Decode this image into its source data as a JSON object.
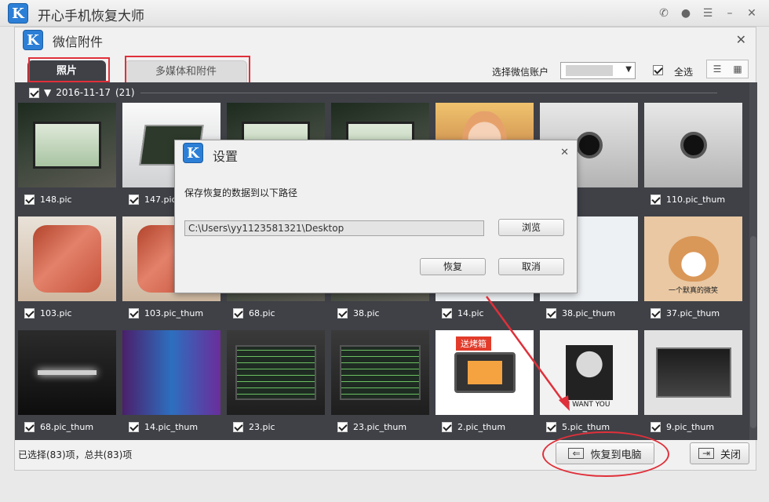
{
  "app": {
    "title": "开心手机恢复大师",
    "logo_letter": "K"
  },
  "dialog": {
    "title": "微信附件",
    "tabs": [
      {
        "label": "照片"
      },
      {
        "label": "多媒体和附件"
      }
    ],
    "account_label": "选择微信账户",
    "select_all_label": "全选",
    "group": {
      "date": "2016-11-17",
      "count": "(21)"
    },
    "items": [
      {
        "label": "148.pic",
        "img": "pc"
      },
      {
        "label": "147.pic",
        "img": "laptop"
      },
      {
        "label": "",
        "img": "pc"
      },
      {
        "label": "",
        "img": "pc"
      },
      {
        "label": "",
        "img": "singer"
      },
      {
        "label": "ic",
        "img": "watch"
      },
      {
        "label": "110.pic_thum",
        "img": "watch"
      },
      {
        "label": "103.pic",
        "img": "meat"
      },
      {
        "label": "103.pic_thum",
        "img": "meat"
      },
      {
        "label": "68.pic",
        "img": "pc"
      },
      {
        "label": "38.pic",
        "img": "pc"
      },
      {
        "label": "14.pic",
        "img": "chat"
      },
      {
        "label": "38.pic_thum",
        "img": "chat"
      },
      {
        "label": "37.pic_thum",
        "img": "dog"
      },
      {
        "label": "68.pic_thum",
        "img": "dark"
      },
      {
        "label": "14.pic_thum",
        "img": "game"
      },
      {
        "label": "23.pic",
        "img": "code"
      },
      {
        "label": "23.pic_thum",
        "img": "code"
      },
      {
        "label": "2.pic_thum",
        "img": "oven"
      },
      {
        "label": "5.pic_thum",
        "img": "poster"
      },
      {
        "label": "9.pic_thum",
        "img": "box"
      }
    ],
    "image_texts": {
      "oven_banner": "送烤箱",
      "dog_caption": "一个默真的微笑",
      "poster_caption": "I WANT YOU"
    },
    "status": "已选择(83)项，总共(83)项",
    "restore_button": "恢复到电脑",
    "close_button": "关闭"
  },
  "settings": {
    "title": "设置",
    "prompt": "保存恢复的数据到以下路径",
    "path": "C:\\Users\\yy1123581321\\Desktop",
    "browse": "浏览",
    "restore": "恢复",
    "cancel": "取消"
  },
  "colors": {
    "accent_red": "#e0303a",
    "gallery_bg": "#3f4147",
    "logo_blue": "#2c7fd6"
  }
}
